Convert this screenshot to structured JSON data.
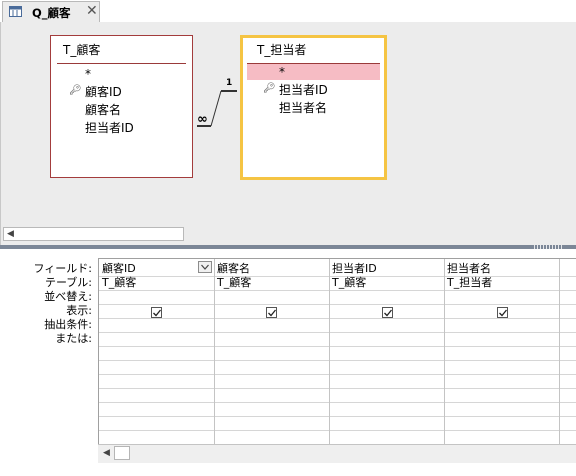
{
  "tab": {
    "title": "Q_顧客",
    "close": "✕"
  },
  "tables": {
    "kokyaku": {
      "name": "T_顧客",
      "fields": [
        "*",
        "顧客ID",
        "顧客名",
        "担当者ID"
      ]
    },
    "tantou": {
      "name": "T_担当者",
      "fields": [
        "*",
        "担当者ID",
        "担当者名"
      ]
    }
  },
  "relationship": {
    "one_label": "1",
    "many_label": "∞"
  },
  "row_labels": [
    "フィールド:",
    "テーブル:",
    "並べ替え:",
    "表示:",
    "抽出条件:",
    "または:"
  ],
  "columns": [
    {
      "field": "顧客ID",
      "table": "T_顧客",
      "show": true
    },
    {
      "field": "顧客名",
      "table": "T_顧客",
      "show": true
    },
    {
      "field": "担当者ID",
      "table": "T_顧客",
      "show": true
    },
    {
      "field": "担当者名",
      "table": "T_担当者",
      "show": true
    }
  ],
  "colors": {
    "accent": "#f5c443",
    "table_border": "#a33c3c",
    "selection": "#f6bcc4"
  }
}
